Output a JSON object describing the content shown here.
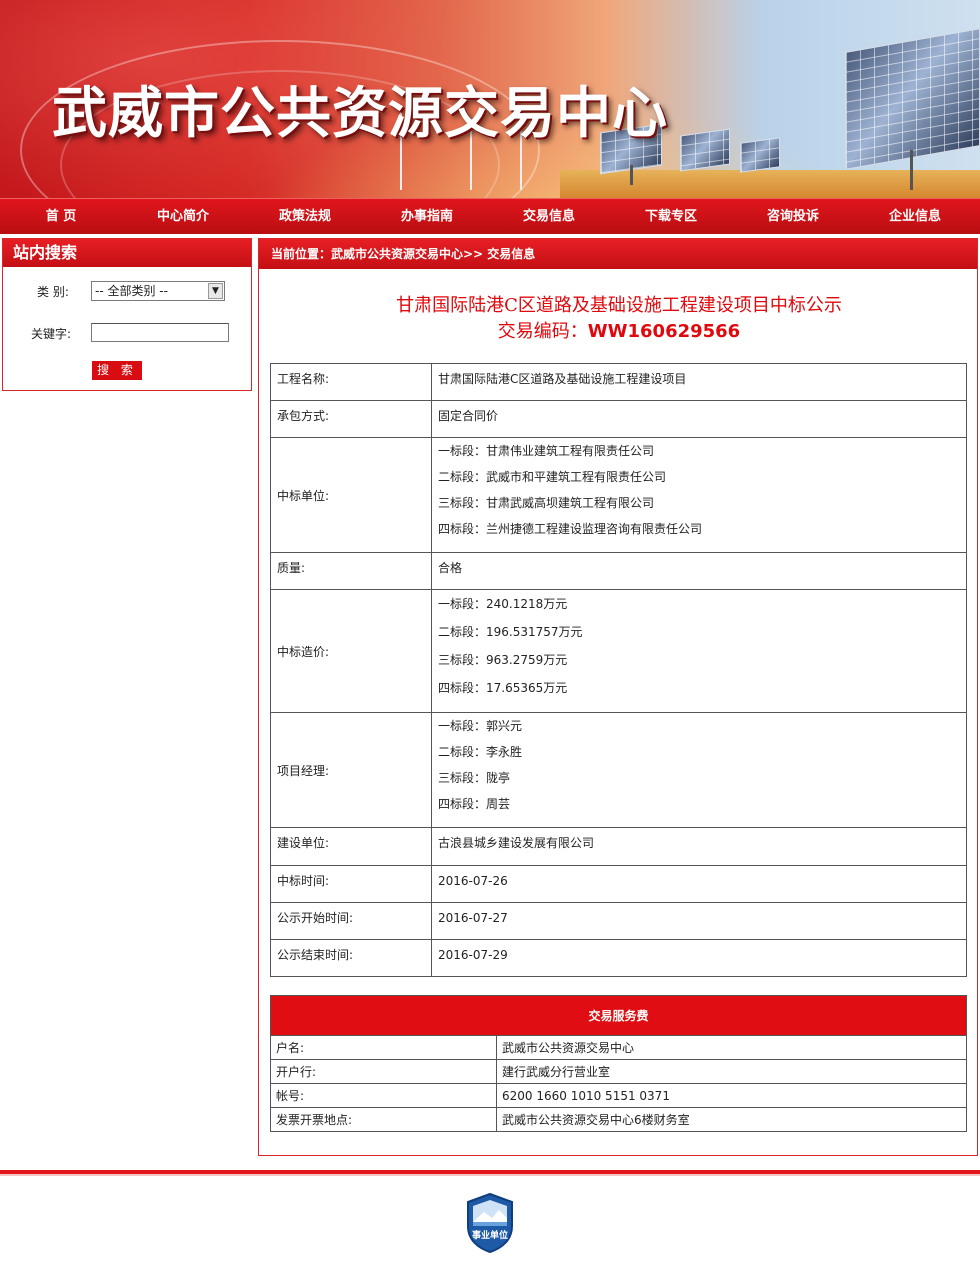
{
  "banner": {
    "title": "武威市公共资源交易中心"
  },
  "nav": {
    "items": [
      "首  页",
      "中心简介",
      "政策法规",
      "办事指南",
      "交易信息",
      "下载专区",
      "咨询投诉",
      "企业信息"
    ]
  },
  "search": {
    "title": "站内搜索",
    "category_label": "类  别:",
    "category_value": "-- 全部类别 --",
    "keyword_label": "关键字:",
    "keyword_value": "",
    "button": "搜 索"
  },
  "breadcrumb": "当前位置：武威市公共资源交易中心>> 交易信息",
  "notice": {
    "title": "甘肃国际陆港C区道路及基础设施工程建设项目中标公示",
    "code_label": "交易编码：",
    "code_value": "WW160629566"
  },
  "details": {
    "project_name_label": "工程名称:",
    "project_name": "甘肃国际陆港C区道路及基础设施工程建设项目",
    "contract_label": "承包方式:",
    "contract": "固定合同价",
    "winner_label": "中标单位:",
    "winners": [
      "一标段：甘肃伟业建筑工程有限责任公司",
      "二标段：武威市和平建筑工程有限责任公司",
      "三标段：甘肃武威高坝建筑工程有限公司",
      "四标段：兰州捷德工程建设监理咨询有限责任公司"
    ],
    "quality_label": "质量:",
    "quality": "合格",
    "price_label": "中标造价:",
    "prices": [
      "一标段：240.1218万元",
      "二标段：196.531757万元",
      "三标段：963.2759万元",
      "四标段：17.65365万元"
    ],
    "manager_label": "项目经理:",
    "managers": [
      "一标段：郭兴元",
      "二标段：李永胜",
      "三标段：陇亭",
      "四标段：周芸"
    ],
    "builder_label": "建设单位:",
    "builder": "古浪县城乡建设发展有限公司",
    "award_time_label": "中标时间:",
    "award_time": "2016-07-26",
    "start_label": "公示开始时间:",
    "start": "2016-07-27",
    "end_label": "公示结束时间:",
    "end": "2016-07-29"
  },
  "fee": {
    "title": "交易服务费",
    "rows": [
      {
        "k": "户名:",
        "v": "武威市公共资源交易中心"
      },
      {
        "k": "开户行:",
        "v": "建行武威分行营业室"
      },
      {
        "k": "帐号:",
        "v": "6200 1660 1010 5151 0371"
      },
      {
        "k": "发票开票地点:",
        "v": "武威市公共资源交易中心6楼财务室"
      }
    ]
  },
  "footer": {
    "badge_text": "事业单位"
  },
  "colors": {
    "primary_red": "#e0161c",
    "title_red": "#e0080c"
  }
}
